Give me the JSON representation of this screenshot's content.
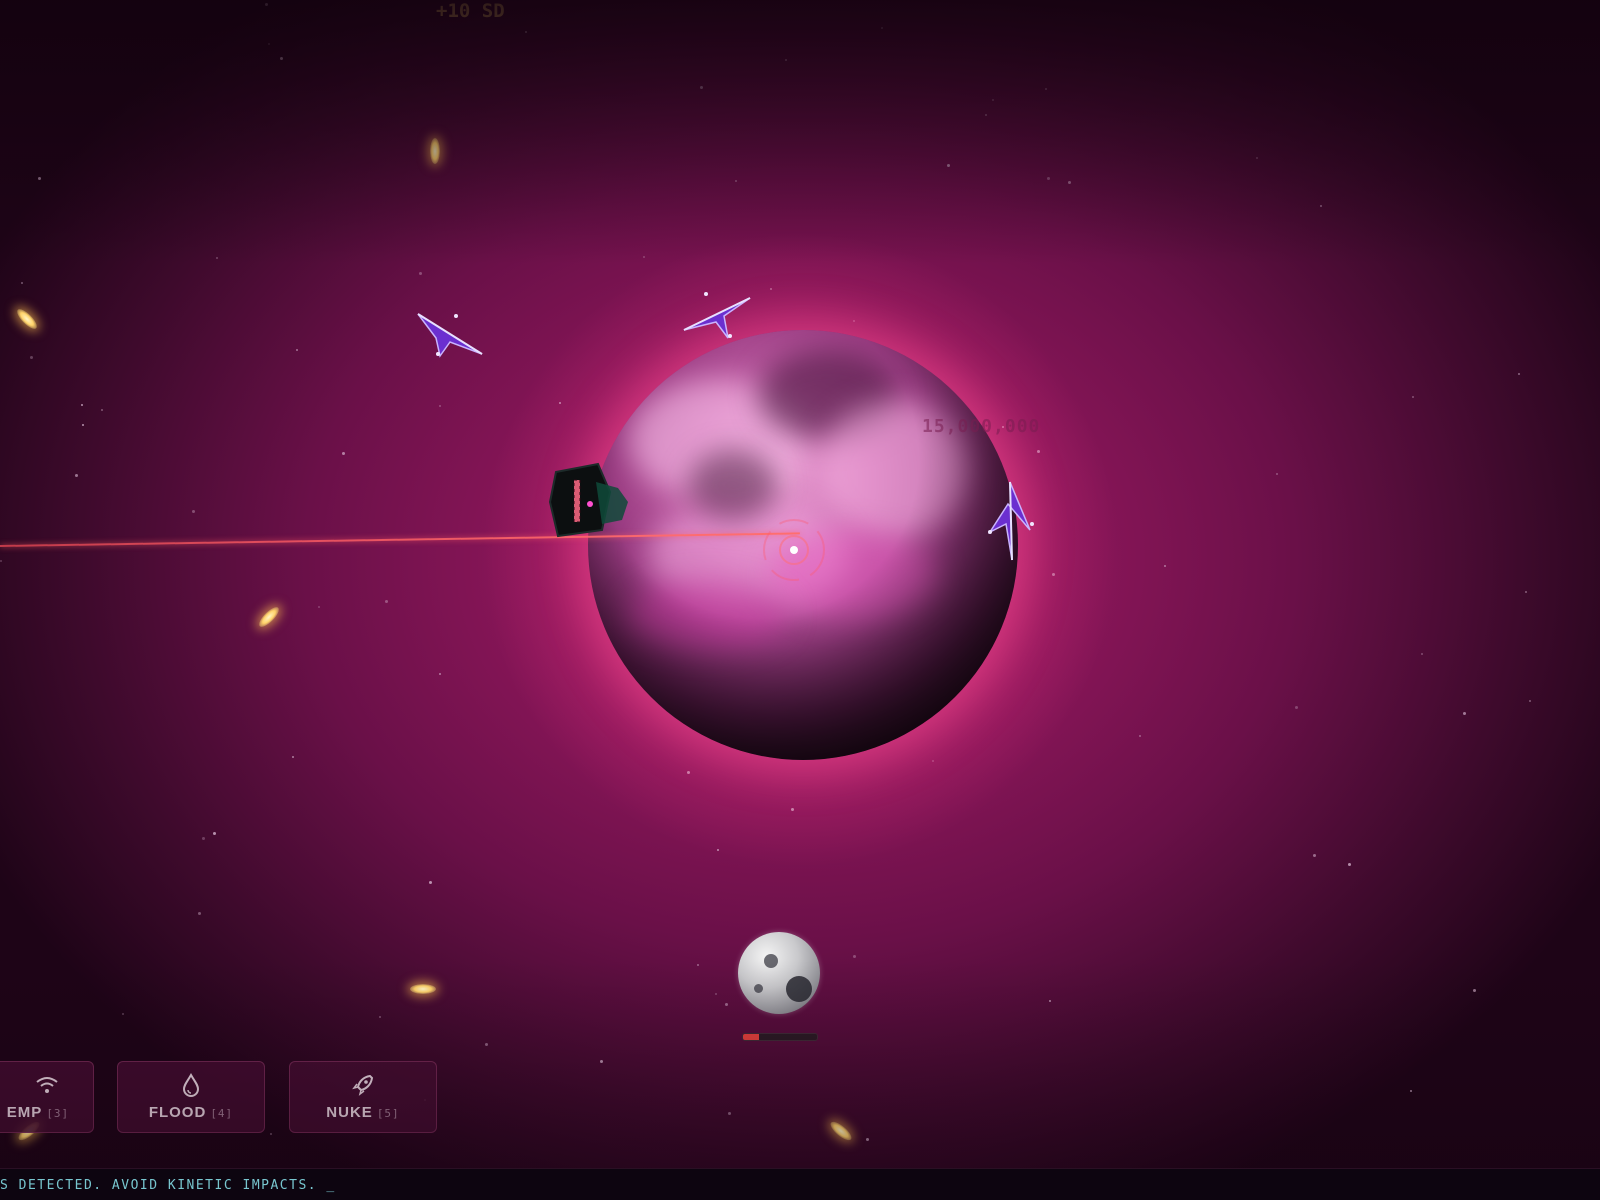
{
  "hud": {
    "score_gain": "+10 SD",
    "planet_value": "15,000,000"
  },
  "abilities": [
    {
      "label": "EMP",
      "key": "[3]",
      "icon": "wifi-icon"
    },
    {
      "label": "FLOOD",
      "key": "[4]",
      "icon": "droplet-icon"
    },
    {
      "label": "NUKE",
      "key": "[5]",
      "icon": "rocket-icon"
    }
  ],
  "moon": {
    "health_fraction": 0.22
  },
  "status": {
    "message": "S DETECTED. AVOID KINETIC IMPACTS. _"
  },
  "colors": {
    "laser": "#ff6a72",
    "projectile": "#ffd36a",
    "status_text": "#78c6cf",
    "score_text": "#d6a85a",
    "health_bar": "#e0403c"
  }
}
